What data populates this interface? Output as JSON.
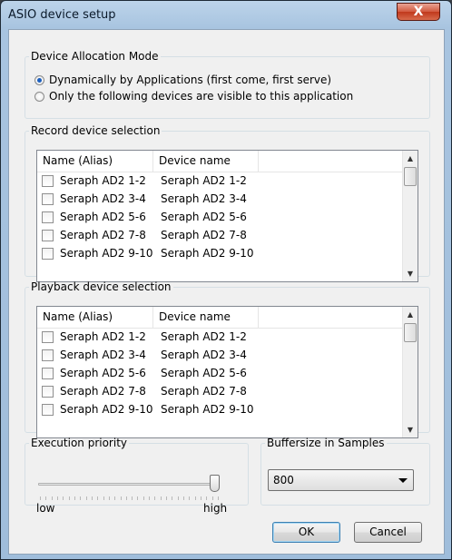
{
  "window": {
    "title": "ASIO device setup",
    "close_label": "X"
  },
  "allocation": {
    "legend": "Device Allocation Mode",
    "options": [
      {
        "label": "Dynamically by Applications (first come, first serve)",
        "selected": true
      },
      {
        "label": "Only the following devices are visible to this application",
        "selected": false
      }
    ]
  },
  "record": {
    "legend": "Record device selection",
    "columns": [
      "Name (Alias)",
      "Device name"
    ],
    "rows": [
      {
        "alias": "Seraph AD2 1-2",
        "device": "Seraph AD2 1-2",
        "checked": false
      },
      {
        "alias": "Seraph AD2 3-4",
        "device": "Seraph AD2 3-4",
        "checked": false
      },
      {
        "alias": "Seraph AD2 5-6",
        "device": "Seraph AD2 5-6",
        "checked": false
      },
      {
        "alias": "Seraph AD2 7-8",
        "device": "Seraph AD2 7-8",
        "checked": false
      },
      {
        "alias": "Seraph AD2 9-10",
        "device": "Seraph AD2 9-10",
        "checked": false
      }
    ]
  },
  "playback": {
    "legend": "Playback device selection",
    "columns": [
      "Name (Alias)",
      "Device name"
    ],
    "rows": [
      {
        "alias": "Seraph AD2 1-2",
        "device": "Seraph AD2 1-2",
        "checked": false
      },
      {
        "alias": "Seraph AD2 3-4",
        "device": "Seraph AD2 3-4",
        "checked": false
      },
      {
        "alias": "Seraph AD2 5-6",
        "device": "Seraph AD2 5-6",
        "checked": false
      },
      {
        "alias": "Seraph AD2 7-8",
        "device": "Seraph AD2 7-8",
        "checked": false
      },
      {
        "alias": "Seraph AD2 9-10",
        "device": "Seraph AD2 9-10",
        "checked": false
      }
    ]
  },
  "priority": {
    "legend": "Execution priority",
    "low_label": "low",
    "high_label": "high",
    "level": 1.0
  },
  "buffer": {
    "legend": "Buffersize in Samples",
    "value": "800"
  },
  "buttons": {
    "ok": "OK",
    "cancel": "Cancel"
  },
  "icons": {
    "up": "scroll-up-arrow",
    "down": "scroll-down-arrow",
    "dropdown": "chevron-down"
  }
}
